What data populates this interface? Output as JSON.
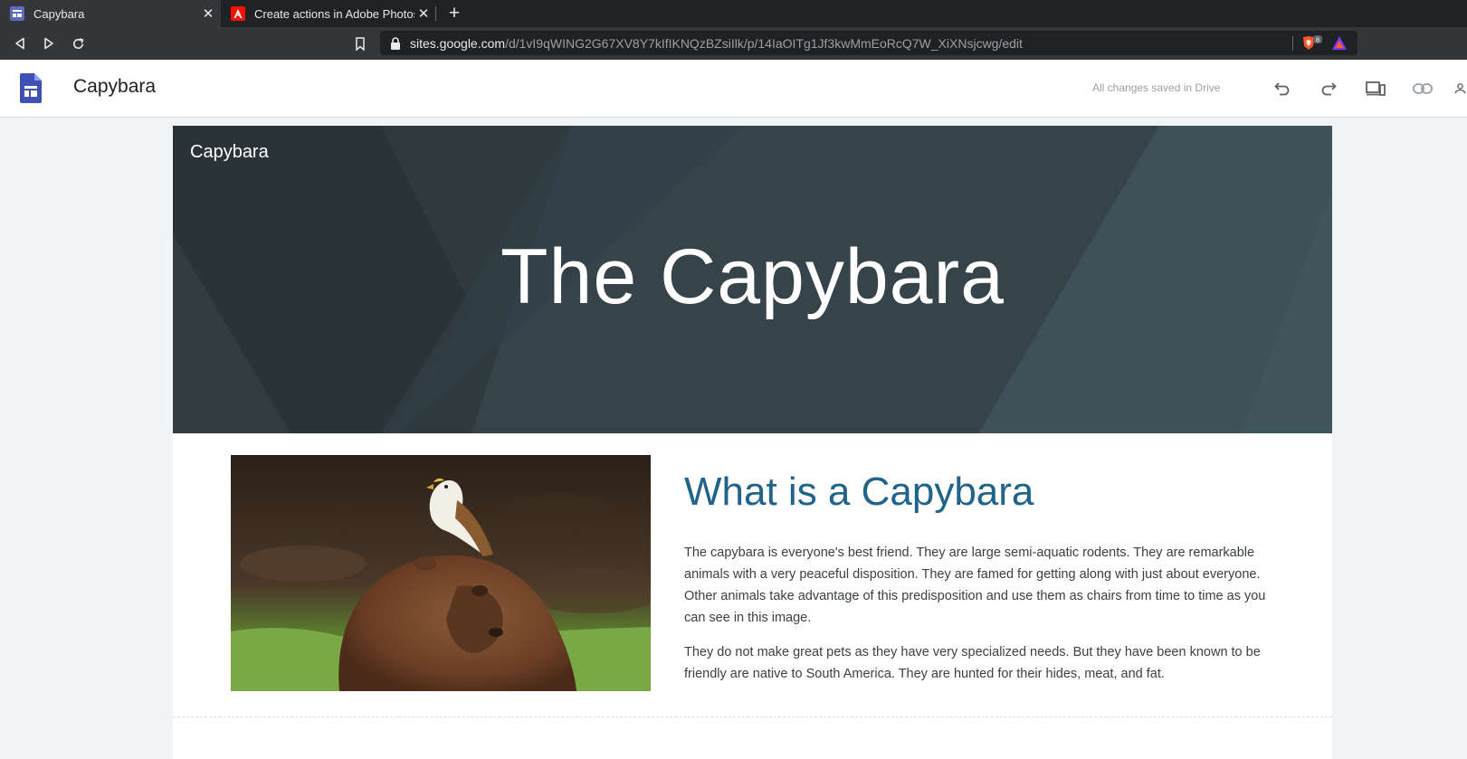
{
  "browser": {
    "tabs": [
      {
        "title": "Capybara",
        "active": true
      },
      {
        "title": "Create actions in Adobe Photoshop",
        "active": false
      }
    ],
    "url_host": "sites.google.com",
    "url_path": "/d/1vI9qWING2G67XV8Y7kIfIKNQzBZsiIlk/p/14IaOITg1Jf3kwMmEoRcQ7W_XiXNsjcwg/edit",
    "extension_badge": "8"
  },
  "editor": {
    "doc_title": "Capybara",
    "save_status": "All changes saved in Drive",
    "icons": [
      "undo-icon",
      "redo-icon",
      "preview-devices-icon",
      "link-icon",
      "share-person-icon"
    ]
  },
  "site": {
    "site_name": "Capybara",
    "banner_title": "The Capybara",
    "section_heading": "What is a Capybara",
    "paragraph1": "The capybara is everyone's best friend. They are large semi-aquatic rodents. They are remarkable animals with a very peaceful disposition. They are famed for getting along with just about everyone. Other animals take advantage of this predisposition and use them as chairs from time to time as you can see in this image.",
    "paragraph2": "They do not make great pets as they have very specialized needs. But they have been known to be friendly are native to South America. They are hunted for their hides, meat, and fat."
  },
  "colors": {
    "banner": "#36434a",
    "heading": "#20648c",
    "sites_brand": "#3f51b5"
  }
}
